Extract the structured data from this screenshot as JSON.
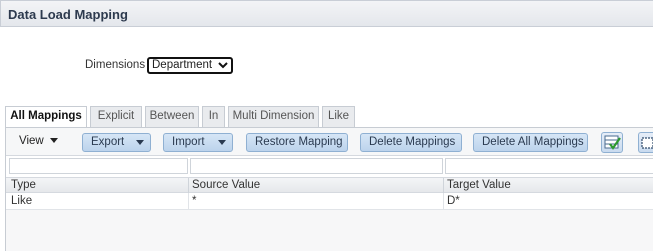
{
  "header": {
    "title": "Data Load Mapping"
  },
  "dimension": {
    "label": "Dimensions",
    "selected": "Department"
  },
  "tabs": [
    {
      "label": "All Mappings",
      "active": true
    },
    {
      "label": "Explicit",
      "active": false
    },
    {
      "label": "Between",
      "active": false
    },
    {
      "label": "In",
      "active": false
    },
    {
      "label": "Multi Dimension",
      "active": false
    },
    {
      "label": "Like",
      "active": false
    }
  ],
  "toolbar": {
    "view": "View",
    "export": "Export",
    "import": "Import",
    "restore": "Restore Mapping",
    "delete": "Delete Mappings",
    "delete_all": "Delete All Mappings"
  },
  "table": {
    "columns": [
      "Type",
      "Source Value",
      "Target Value"
    ],
    "rows": [
      [
        "Like",
        "*",
        "D*"
      ]
    ]
  },
  "colors": {
    "accent": "#bcd3ec",
    "title": "#2d3a4e"
  }
}
